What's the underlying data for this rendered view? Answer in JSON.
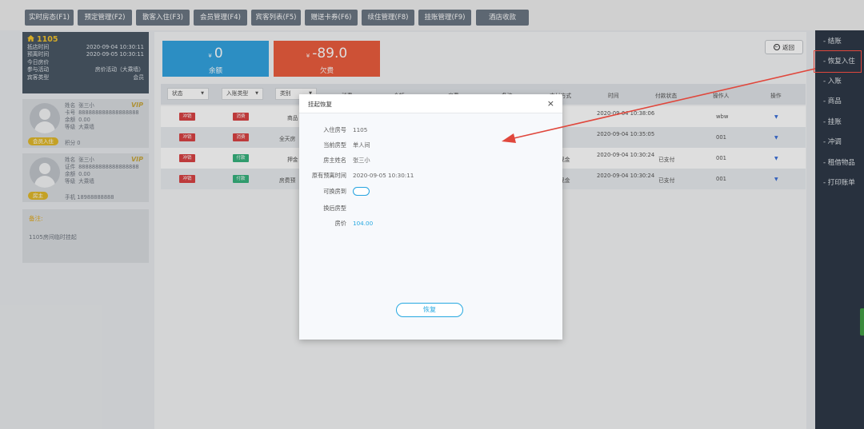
{
  "top_nav": {
    "tabs": [
      {
        "label": "实时房态(F1)"
      },
      {
        "label": "预定管理(F2)"
      },
      {
        "label": "散客入住(F3)"
      },
      {
        "label": "会员管理(F4)"
      },
      {
        "label": "宾客列表(F5)"
      },
      {
        "label": "赠送卡券(F6)"
      },
      {
        "label": "续住管理(F8)"
      },
      {
        "label": "挂账管理(F9)"
      },
      {
        "label": "酒店收款"
      }
    ]
  },
  "room_card": {
    "room_number": "1105",
    "rows": [
      {
        "label": "抵店时间",
        "value": "2020-09-04 10:30:11"
      },
      {
        "label": "预离时间",
        "value": "2020-09-05 10:30:11"
      },
      {
        "label": "今日房价",
        "value": ""
      },
      {
        "label": "参与活动",
        "value": "房价活动（大乘墙）"
      },
      {
        "label": "宾客类型",
        "value": "会员"
      }
    ]
  },
  "guest_cards": [
    {
      "vip": "VIP",
      "lines": [
        {
          "label": "姓名",
          "value": "张三小"
        },
        {
          "label": "卡号",
          "value": "888888888888888888"
        },
        {
          "label": "余额",
          "value": "0.00"
        },
        {
          "label": "等级",
          "value": "大乘墙"
        }
      ],
      "badge": "会员入住",
      "side_label": "积分",
      "side_value": "0"
    },
    {
      "vip": "VIP",
      "lines": [
        {
          "label": "姓名",
          "value": "张三小"
        },
        {
          "label": "证件",
          "value": "888888888888888888"
        },
        {
          "label": "余额",
          "value": "0.00"
        },
        {
          "label": "等级",
          "value": "大乘墙"
        }
      ],
      "badge": "房主",
      "side_label": "手机",
      "side_value": "18988888888"
    }
  ],
  "note": {
    "title": "备注:",
    "text": "1105房间临时挂起"
  },
  "stats": {
    "balance": {
      "value": "0",
      "label": "余额",
      "color": "#33a4e0"
    },
    "owed": {
      "value": "-89.0",
      "label": "欠费",
      "color": "#ec5d3e"
    }
  },
  "back_button": {
    "label": "返回"
  },
  "table": {
    "filters": [
      "状态",
      "入账类型",
      "类别"
    ],
    "headers": [
      "消费",
      "金额",
      "房费",
      "备注",
      "支付方式",
      "时间",
      "付款状态",
      "操作人",
      "操作"
    ],
    "rows": [
      {
        "status": "冲销",
        "type": "消费",
        "category": "商品",
        "pay": "",
        "time": "2020-09-04 10:38:06",
        "pay_status": "",
        "operator": "wbw"
      },
      {
        "status": "冲销",
        "type": "消费",
        "category": "全天房",
        "pay": "",
        "time": "2020-09-04 10:35:05",
        "pay_status": "",
        "operator": "001"
      },
      {
        "status": "冲销",
        "type": "付款",
        "category": "押金",
        "pay": "现金",
        "time": "2020-09-04 10:30:24",
        "pay_status": "已支付",
        "operator": "001"
      },
      {
        "status": "冲销",
        "type": "付款",
        "category": "房费预",
        "pay": "现金",
        "time": "2020-09-04 10:30:24",
        "pay_status": "已支付",
        "operator": "001"
      }
    ]
  },
  "right_sidebar": {
    "items": [
      {
        "label": "结账"
      },
      {
        "label": "恢复入住"
      },
      {
        "label": "入账"
      },
      {
        "label": "商品"
      },
      {
        "label": "挂账"
      },
      {
        "label": "冲调"
      },
      {
        "label": "租借物品"
      },
      {
        "label": "打印账单"
      }
    ]
  },
  "modal": {
    "title": "挂起恢复",
    "close": "×",
    "fields": [
      {
        "label": "入住房号",
        "value": "1105"
      },
      {
        "label": "当前房型",
        "value": "单人间"
      },
      {
        "label": "房主姓名",
        "value": "张三小"
      },
      {
        "label": "原有预离时间",
        "value": "2020-09-05 10:30:11"
      },
      {
        "label": "可换房到",
        "value": ""
      },
      {
        "label": "换后房型",
        "value": ""
      },
      {
        "label": "房价",
        "value": "104.00"
      }
    ],
    "restore_button": "恢复"
  },
  "colors": {
    "accent": "#26a8e0",
    "sidebar_bg": "#2e3948",
    "highlight": "#e0473c",
    "vip_gold": "#c8a73d"
  }
}
